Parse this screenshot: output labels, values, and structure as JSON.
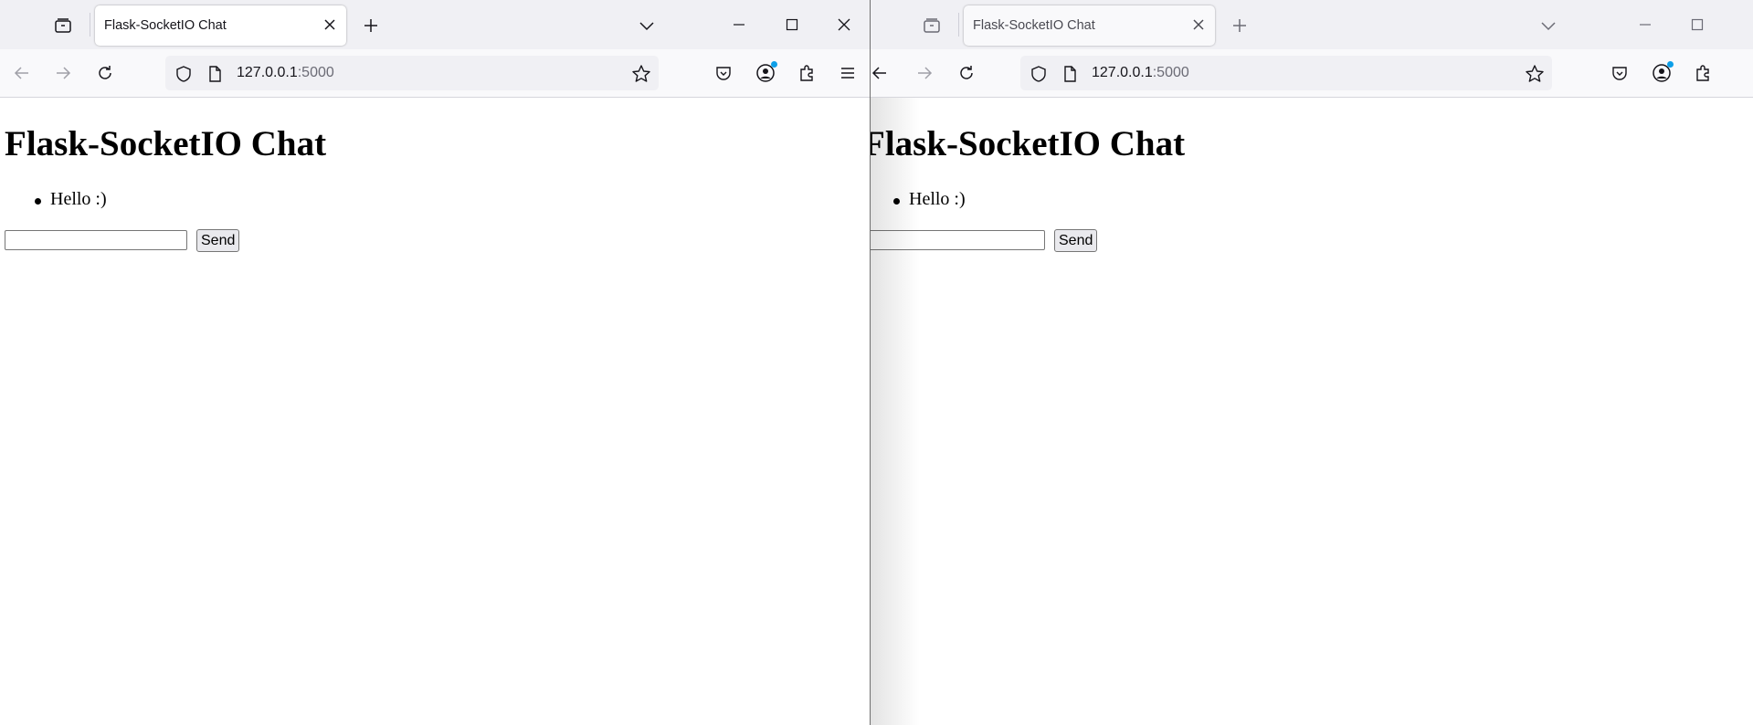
{
  "windows": [
    {
      "tab_title": "Flask-SocketIO Chat",
      "url_host": "127.0.0.1",
      "url_port": ":5000",
      "page": {
        "heading": "Flask-SocketIO Chat",
        "messages": [
          "Hello :)"
        ],
        "input_value": "",
        "send_label": "Send"
      }
    },
    {
      "tab_title": "Flask-SocketIO Chat",
      "url_host": "127.0.0.1",
      "url_port": ":5000",
      "page": {
        "heading": "Flask-SocketIO Chat",
        "messages": [
          "Hello :)"
        ],
        "input_value": "",
        "send_label": "Send"
      }
    }
  ],
  "colors": {
    "tabbar_bg": "#f0f0f4",
    "navbar_bg": "#f9f9fb",
    "notification_dot": "#0d9fe8"
  }
}
